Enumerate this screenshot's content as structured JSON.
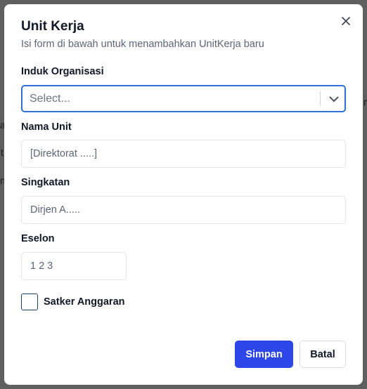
{
  "backdrop": {
    "fragments": [
      "m",
      "a",
      "t",
      "n"
    ]
  },
  "modal": {
    "title": "Unit Kerja",
    "subtitle": "Isi form di bawah untuk menambahkan UnitKerja baru",
    "close_icon": "close-icon",
    "fields": {
      "induk_organisasi": {
        "label": "Induk Organisasi",
        "placeholder": "Select...",
        "chevron_icon": "chevron-down-icon"
      },
      "nama_unit": {
        "label": "Nama Unit",
        "placeholder": "[Direktorat .....]"
      },
      "singkatan": {
        "label": "Singkatan",
        "placeholder": "Dirjen A....."
      },
      "eselon": {
        "label": "Eselon",
        "placeholder": "1 2 3"
      },
      "satker_anggaran": {
        "label": "Satker Anggaran",
        "checked": false
      }
    },
    "buttons": {
      "submit": "Simpan",
      "cancel": "Batal"
    },
    "colors": {
      "primary": "#2d46e8",
      "focus_border": "#2f6fd6",
      "backdrop": "#5f5f5f"
    }
  }
}
